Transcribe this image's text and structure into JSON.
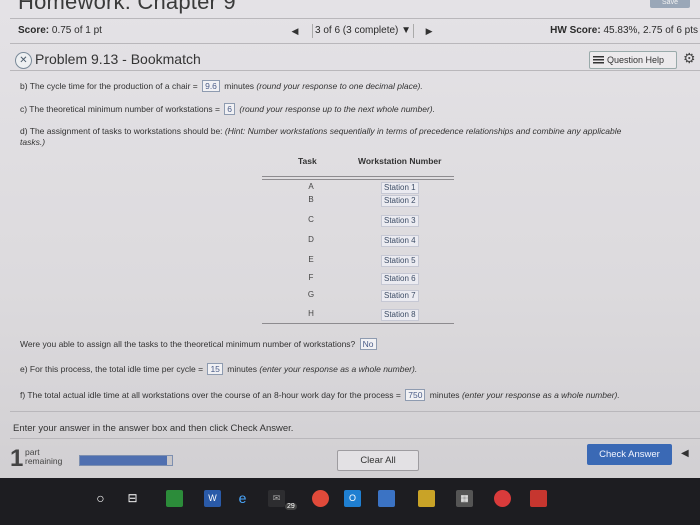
{
  "header": {
    "title": "Homework: Chapter 9",
    "save_label": "Save"
  },
  "scorebar": {
    "score_label": "Score:",
    "score_value": "0.75 of 1 pt",
    "nav_selected": "3 of 6 (3 complete)",
    "hw_label": "HW Score:",
    "hw_value": "45.83%, 2.75 of 6 pts"
  },
  "problem": {
    "title": "Problem 9.13 - Bookmatch",
    "question_help_label": "Question Help"
  },
  "parts": {
    "b_text": "b) The cycle time for the production of a chair = ",
    "b_value": "9.6",
    "b_unit": " minutes ",
    "b_hint": "(round your response to one decimal place).",
    "c_text": "c) The theoretical minimum number of workstations = ",
    "c_value": "6",
    "c_hint": " (round your response up to the next whole number).",
    "d_text": "d) The assignment of tasks to workstations should be: ",
    "d_hint_1": "(Hint: Number workstations sequentially in terms of precedence relationships and combine any applicable",
    "d_hint_2": "tasks.)"
  },
  "table": {
    "headers": [
      "Task",
      "Workstation Number"
    ],
    "rows": [
      {
        "task": "A",
        "station": "Station 1"
      },
      {
        "task": "B",
        "station": "Station 2"
      },
      {
        "task": "C",
        "station": "Station 3"
      },
      {
        "task": "D",
        "station": "Station 4"
      },
      {
        "task": "E",
        "station": "Station 5"
      },
      {
        "task": "F",
        "station": "Station 6"
      },
      {
        "task": "G",
        "station": "Station 7"
      },
      {
        "task": "H",
        "station": "Station 8"
      }
    ]
  },
  "after_table": {
    "assign_q": "Were you able to assign all the tasks to the theoretical minimum number of workstations?",
    "assign_ans": "No",
    "e_text": "e) For this process, the total idle time per cycle = ",
    "e_value": "15",
    "e_unit": " minutes ",
    "e_hint": "(enter your response as a whole number).",
    "f_text": "f) The total actual idle time at all workstations over the course of an 8-hour work day for the process = ",
    "f_value": "750",
    "f_unit": " minutes ",
    "f_hint": "(enter your response as a whole number)."
  },
  "instruction": "Enter your answer in the answer box and then click Check Answer.",
  "footer": {
    "parts_count": "1",
    "parts_label_1": "part",
    "parts_label_2": "remaining",
    "progress_fraction": 0.95,
    "clear_label": "Clear All",
    "check_label": "Check Answer"
  },
  "taskbar": {
    "badge": "29"
  }
}
